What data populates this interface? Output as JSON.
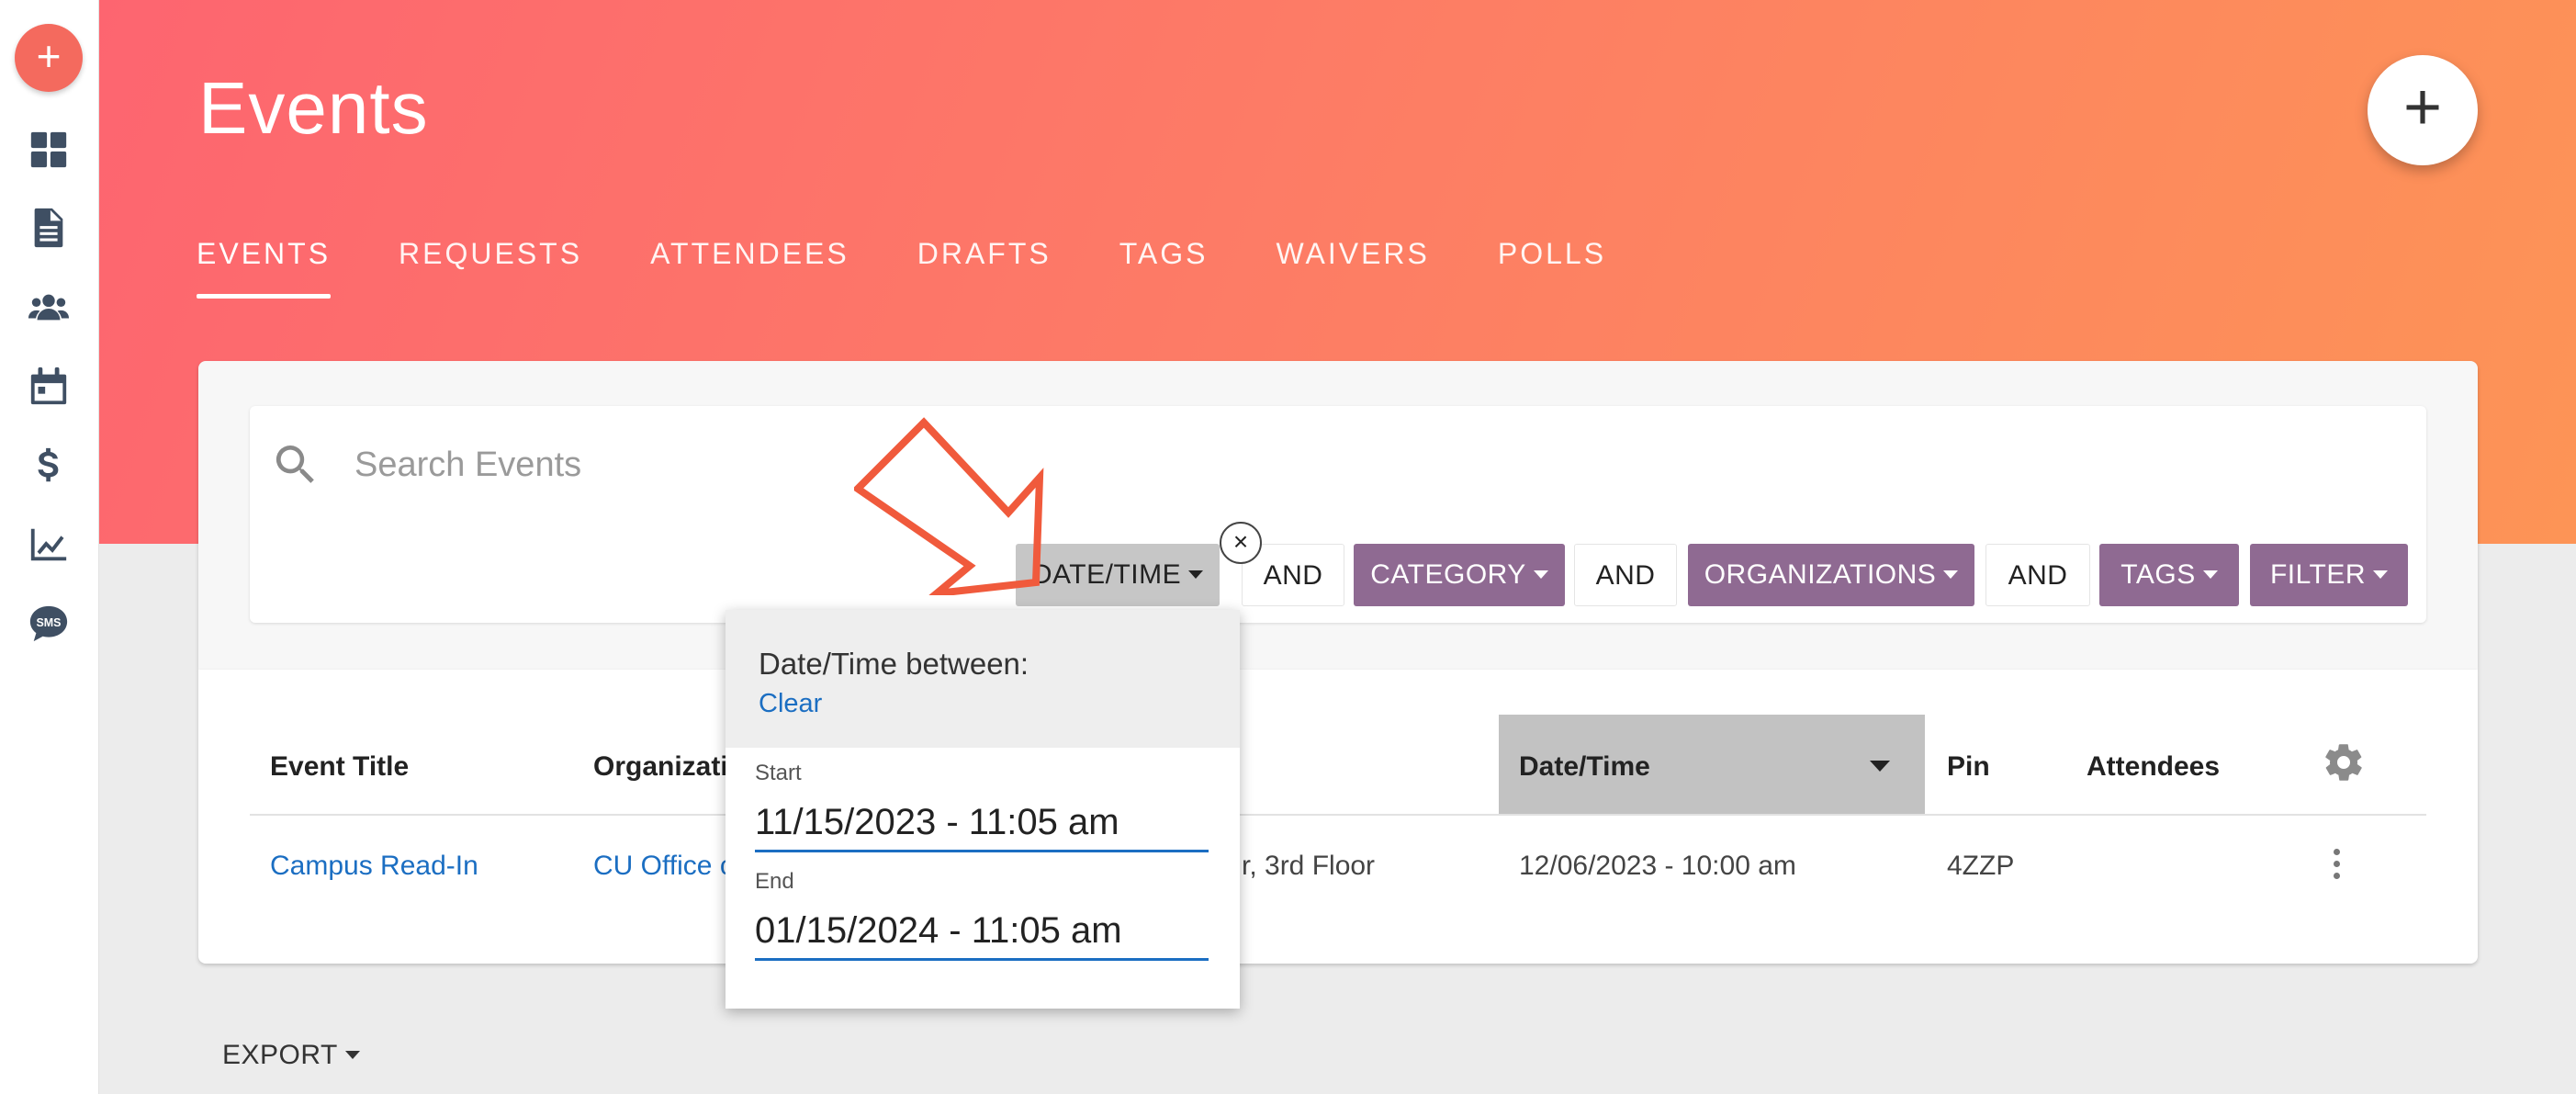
{
  "sidebar": {
    "add_symbol": "+",
    "icons": [
      "dashboard-icon",
      "document-icon",
      "users-icon",
      "calendar-icon",
      "dollar-icon",
      "chart-icon",
      "sms-icon"
    ]
  },
  "header": {
    "title": "Events",
    "add_symbol": "+",
    "tabs": [
      {
        "label": "EVENTS"
      },
      {
        "label": "REQUESTS"
      },
      {
        "label": "ATTENDEES"
      },
      {
        "label": "DRAFTS"
      },
      {
        "label": "TAGS"
      },
      {
        "label": "WAIVERS"
      },
      {
        "label": "POLLS"
      }
    ]
  },
  "search": {
    "placeholder": "Search Events",
    "value": ""
  },
  "filters": {
    "datetime": "DATE/TIME",
    "and1": "AND",
    "category": "CATEGORY",
    "and2": "AND",
    "organizations": "ORGANIZATIONS",
    "and3": "AND",
    "tags": "TAGS",
    "filter": "FILTER",
    "remove_symbol": "×"
  },
  "datetime_popup": {
    "title": "Date/Time between:",
    "clear_label": "Clear",
    "start_label": "Start",
    "start_value": "11/15/2023 - 11:05 am",
    "end_label": "End",
    "end_value": "01/15/2024 - 11:05 am"
  },
  "table": {
    "columns": {
      "title": "Event Title",
      "organization": "Organizatic",
      "datetime": "Date/Time",
      "pin": "Pin",
      "attendees": "Attendees"
    },
    "rows": [
      {
        "title": "Campus Read-In",
        "organization": "CU Office c",
        "location": "r, 3rd Floor",
        "datetime": "12/06/2023 - 10:00 am",
        "pin": "4ZZP",
        "attendees": ""
      }
    ]
  },
  "export_label": "EXPORT",
  "colors": {
    "accent_filter": "#8f6a92",
    "link": "#1b6ec2",
    "annotation_arrow": "#f05a3c"
  }
}
